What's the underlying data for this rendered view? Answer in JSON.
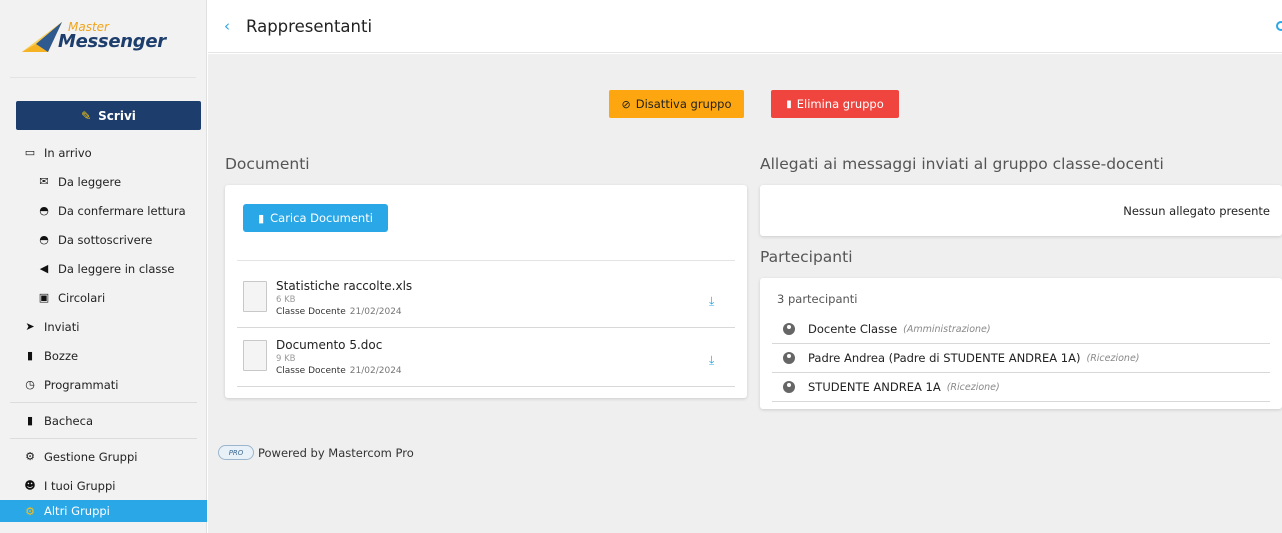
{
  "logo": {
    "line1": "Master",
    "line2": "Messenger"
  },
  "sidebar": {
    "compose_label": "Scrivi",
    "items": [
      {
        "label": "In arrivo",
        "icon": "inbox-icon",
        "level": 0
      },
      {
        "label": "Da leggere",
        "icon": "envelope-icon",
        "level": 1
      },
      {
        "label": "Da confermare lettura",
        "icon": "envelope-open-icon",
        "level": 1
      },
      {
        "label": "Da sottoscrivere",
        "icon": "envelope-open-icon",
        "level": 1
      },
      {
        "label": "Da leggere in classe",
        "icon": "bullhorn-icon",
        "level": 1
      },
      {
        "label": "Circolari",
        "icon": "circular-icon",
        "level": 1
      },
      {
        "label": "Inviati",
        "icon": "paper-plane-icon",
        "level": 0
      },
      {
        "label": "Bozze",
        "icon": "file-icon",
        "level": 0
      },
      {
        "label": "Programmati",
        "icon": "clock-icon",
        "level": 0
      },
      {
        "label": "Bacheca",
        "icon": "clipboard-icon",
        "level": 0
      },
      {
        "label": "Gestione Gruppi",
        "icon": "users-cog-icon",
        "level": 0
      },
      {
        "label": "I tuoi Gruppi",
        "icon": "users-icon",
        "level": 0
      },
      {
        "label": "Altri Gruppi",
        "icon": "cogs-icon",
        "level": 0,
        "active": true
      }
    ]
  },
  "header": {
    "title": "Rappresentanti"
  },
  "actions": {
    "deactivate_label": "Disattiva gruppo",
    "delete_label": "Elimina gruppo"
  },
  "documents": {
    "title": "Documenti",
    "upload_label": "Carica Documenti",
    "files": [
      {
        "name": "Statistiche raccolte.xls",
        "size": "6 KB",
        "owner": "Classe Docente",
        "date": "21/02/2024"
      },
      {
        "name": "Documento 5.doc",
        "size": "9 KB",
        "owner": "Classe Docente",
        "date": "21/02/2024"
      }
    ]
  },
  "attachments": {
    "title": "Allegati ai messaggi inviati al gruppo classe-docenti",
    "empty_text": "Nessun allegato presente"
  },
  "participants": {
    "title": "Partecipanti",
    "count_text": "3 partecipanti",
    "list": [
      {
        "name": "Docente Classe",
        "role": "(Amministrazione)"
      },
      {
        "name": "Padre Andrea (Padre di STUDENTE ANDREA 1A)",
        "role": "(Ricezione)"
      },
      {
        "name": "STUDENTE ANDREA 1A",
        "role": "(Ricezione)"
      }
    ]
  },
  "footer": {
    "powered_text": "Powered by Mastercom Pro",
    "badge_text": "PRO"
  },
  "colors": {
    "primary": "#2aa7e6",
    "navy": "#1d3e6c",
    "warning": "#fda60f",
    "danger": "#f0453f"
  }
}
